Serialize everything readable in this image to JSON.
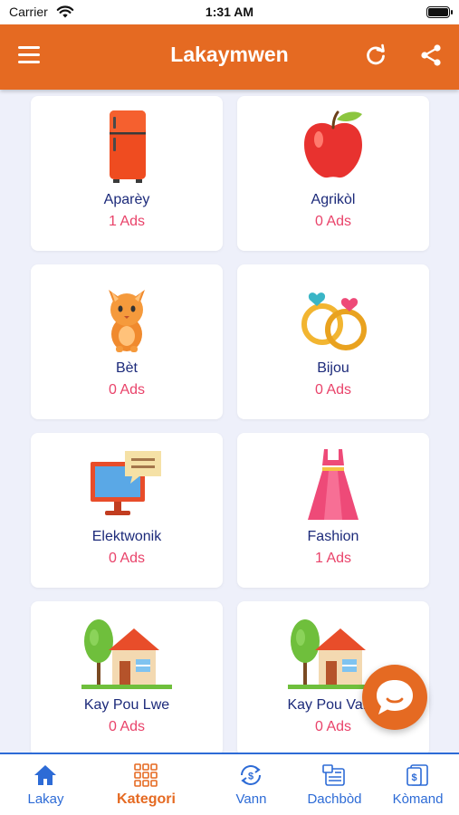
{
  "status_bar": {
    "carrier": "Carrier",
    "time": "1:31 AM"
  },
  "header": {
    "title": "Lakaymwen",
    "menu_icon": "hamburger-menu-icon",
    "refresh_icon": "refresh-icon",
    "share_icon": "share-icon"
  },
  "categories": [
    {
      "name": "Aparèy",
      "count": "1 Ads",
      "icon": "refrigerator-icon"
    },
    {
      "name": "Agrikòl",
      "count": "0 Ads",
      "icon": "apple-icon"
    },
    {
      "name": "Bèt",
      "count": "0 Ads",
      "icon": "cat-icon"
    },
    {
      "name": "Bijou",
      "count": "0 Ads",
      "icon": "rings-icon"
    },
    {
      "name": "Elektwonik",
      "count": "0 Ads",
      "icon": "computer-icon"
    },
    {
      "name": "Fashion",
      "count": "1 Ads",
      "icon": "dress-icon"
    },
    {
      "name": "Kay Pou Lwe",
      "count": "0 Ads",
      "icon": "house-icon"
    },
    {
      "name": "Kay Pou Vann",
      "count": "0 Ads",
      "icon": "house-icon"
    }
  ],
  "chat_button": {
    "icon": "chat-bubble-icon"
  },
  "tabs": [
    {
      "label": "Lakay",
      "icon": "home-icon",
      "active": false
    },
    {
      "label": "Kategori",
      "icon": "grid-icon",
      "active": true
    },
    {
      "label": "Vann",
      "icon": "dollar-exchange-icon",
      "active": false
    },
    {
      "label": "Dachbòd",
      "icon": "dashboard-icon",
      "active": false
    },
    {
      "label": "Kòmand",
      "icon": "orders-icon",
      "active": false
    }
  ],
  "colors": {
    "primary": "#e56a22",
    "accent_blue": "#2d6bd6",
    "category_text": "#1c2a7a",
    "count_text": "#e9436a",
    "background": "#eef0fa"
  }
}
